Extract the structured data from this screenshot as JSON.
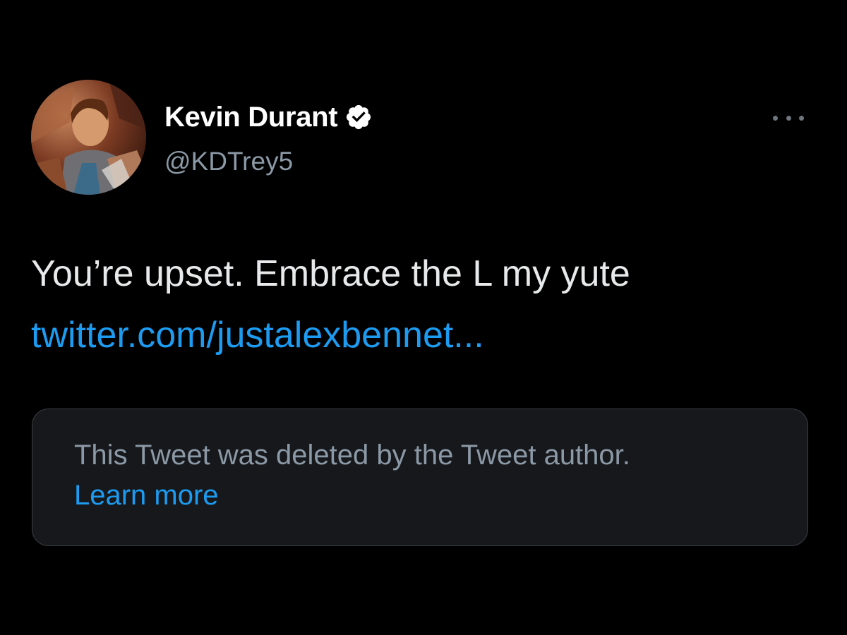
{
  "author": {
    "display_name": "Kevin Durant",
    "handle": "@KDTrey5",
    "verified": true,
    "avatar_icon": "user-avatar"
  },
  "tweet": {
    "text": "You’re upset. Embrace the L my yute",
    "link": "twitter.com/justalexbennet..."
  },
  "quoted": {
    "message": "This Tweet was deleted by the Tweet author.",
    "learn_more": "Learn more"
  },
  "icons": {
    "verified": "verified-badge-icon",
    "more": "more-options-icon"
  },
  "colors": {
    "background": "#000000",
    "text": "#e7e9ea",
    "secondary_text": "#8b98a5",
    "link": "#1d9bf0",
    "card_background": "#16181c",
    "card_border": "#3a3d41"
  }
}
